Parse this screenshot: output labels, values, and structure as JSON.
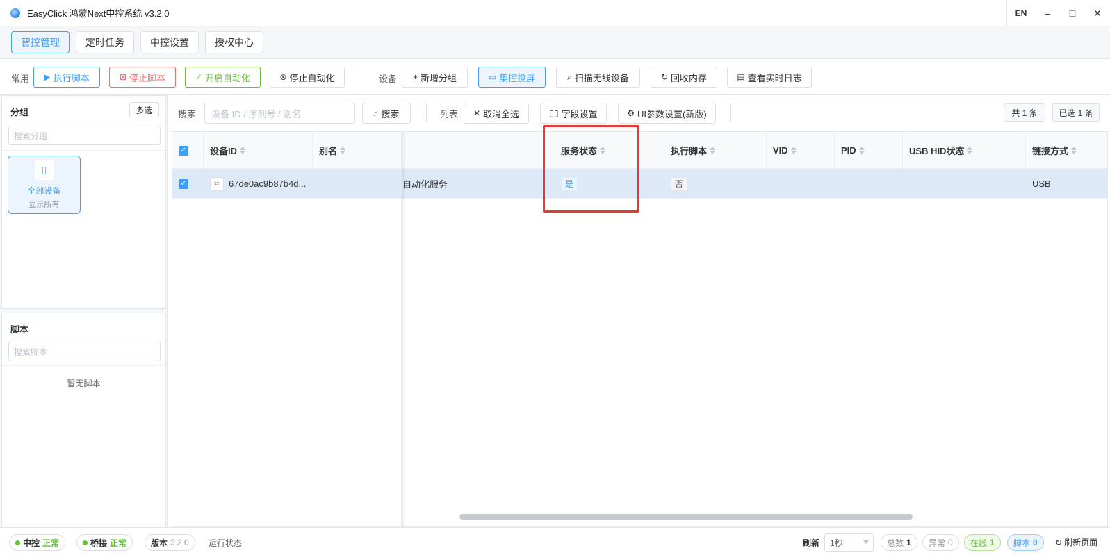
{
  "titlebar": {
    "title": "EasyClick 鸿蒙Next中控系统 v3.2.0",
    "lang": "EN",
    "minimize": "–",
    "maximize": "□",
    "close": "✕"
  },
  "main_tabs": [
    {
      "label": "智控管理",
      "active": true
    },
    {
      "label": "定时任务",
      "active": false
    },
    {
      "label": "中控设置",
      "active": false
    },
    {
      "label": "授权中心",
      "active": false
    }
  ],
  "toolbar": {
    "common_label": "常用",
    "run_script": "执行脚本",
    "stop_script": "停止脚本",
    "start_auto": "开启自动化",
    "stop_auto": "停止自动化",
    "device_label": "设备",
    "add_group": "新增分组",
    "group_screen": "集控投屏",
    "scan_wireless": "扫描无线设备",
    "reclaim_memory": "回收内存",
    "view_log": "查看实时日志"
  },
  "sidebar": {
    "group_title": "分组",
    "multi_select": "多选",
    "group_search_placeholder": "搜索分组",
    "all_devices_label": "全部设备",
    "all_devices_sub": "显示所有",
    "script_title": "脚本",
    "script_search_placeholder": "搜索脚本",
    "no_script": "暂无脚本"
  },
  "filter": {
    "search_label": "搜索",
    "search_placeholder": "设备 ID / 序列号 / 别名",
    "search_button": "搜索",
    "list_label": "列表",
    "deselect_all": "取消全选",
    "field_settings": "字段设置",
    "ui_params": "UI参数设置(新版)",
    "total": "共 1 条",
    "selected": "已选 1 条"
  },
  "table": {
    "columns": [
      "设备ID",
      "别名",
      "服务状态",
      "执行脚本",
      "VID",
      "PID",
      "USB HID状态",
      "链接方式"
    ],
    "rows": [
      {
        "device_id": "67de0ac9b87b4d...",
        "alias": "",
        "partial_text": "自动化服务",
        "service_status": "是",
        "exec_script": "否",
        "vid": "",
        "pid": "",
        "usb_hid": "",
        "link": "USB"
      }
    ]
  },
  "statusbar": {
    "center_label": "中控",
    "center_state": "正常",
    "bridge_label": "桥接",
    "bridge_state": "正常",
    "version_label": "版本",
    "version_value": "3.2.0",
    "run_state": "运行状态",
    "refresh_label": "刷新",
    "refresh_interval": "1秒",
    "total_label": "总数",
    "total_value": "1",
    "error_label": "异常",
    "error_value": "0",
    "online_label": "在线",
    "online_value": "1",
    "script_label": "脚本",
    "script_value": "0",
    "refresh_page": "刷新页面"
  },
  "colors": {
    "primary": "#409eff",
    "danger": "#f56c6c",
    "success": "#67c23a",
    "highlight_box": "#e53935"
  }
}
